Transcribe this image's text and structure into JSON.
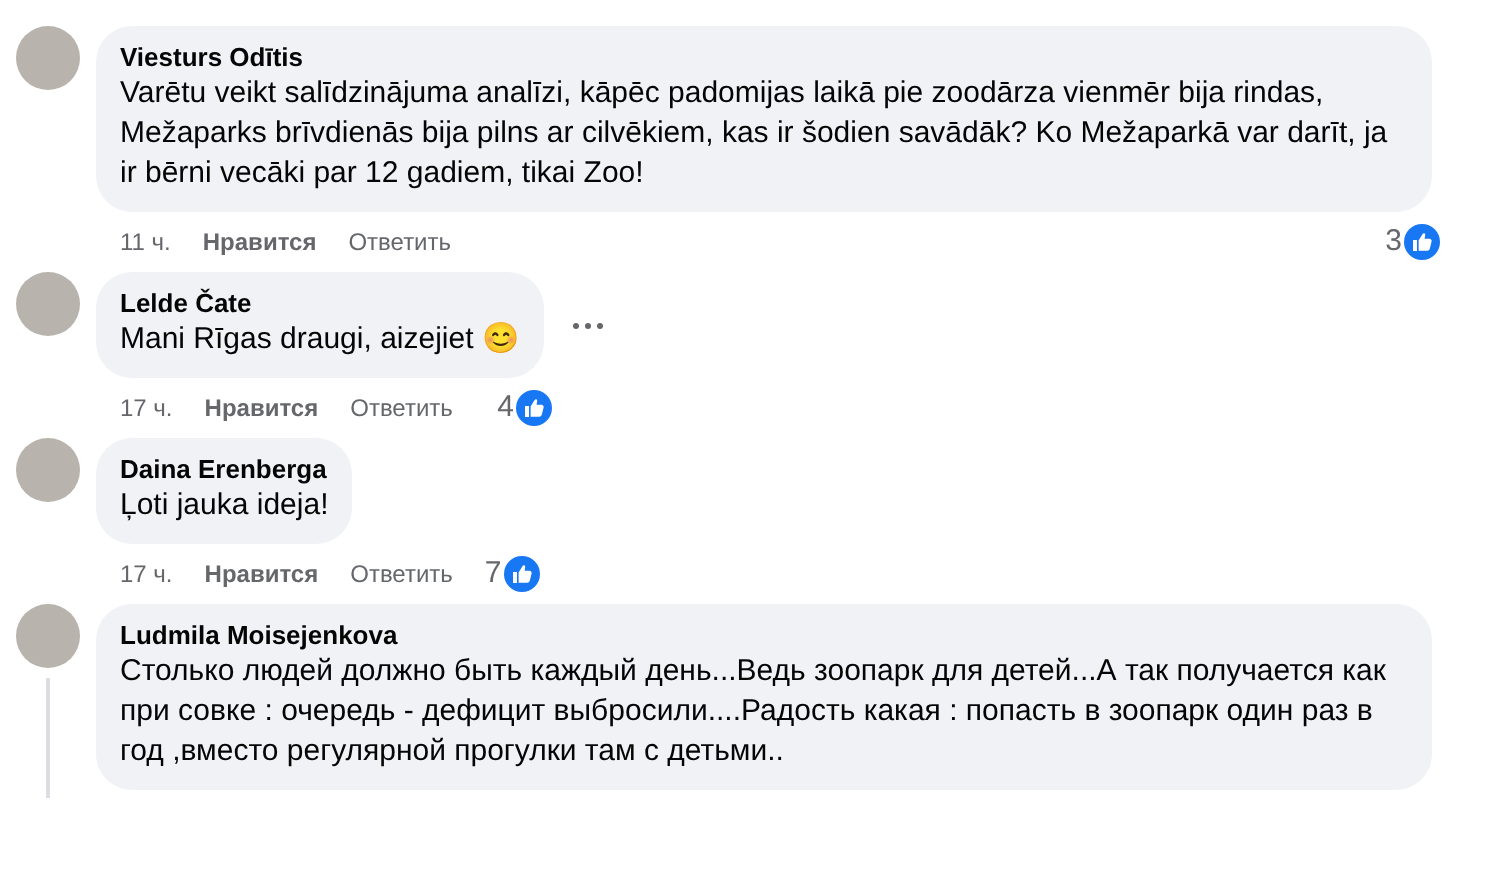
{
  "comments": [
    {
      "author": "Viesturs Odītis",
      "text": "Varētu veikt salīdzinājuma analīzi, kāpēc padomijas laikā pie zoodārza vienmēr bija rindas, Mežaparks brīvdienās bija pilns ar cilvēkiem, kas ir šodien savādāk? Ko Mežaparkā var darīt, ja ir bērni vecāki par 12 gadiem, tikai Zoo!",
      "time": "11 ч.",
      "like": "Нравится",
      "reply": "Ответить",
      "reactions": "3",
      "more_menu": false,
      "thread_line": false
    },
    {
      "author": "Lelde Čate",
      "text": "Mani Rīgas draugi, aizejiet 😊",
      "time": "17 ч.",
      "like": "Нравится",
      "reply": "Ответить",
      "reactions": "4",
      "more_menu": true,
      "thread_line": false
    },
    {
      "author": "Daina Erenberga",
      "text": "Ļoti jauka ideja!",
      "time": "17 ч.",
      "like": "Нравится",
      "reply": "Ответить",
      "reactions": "7",
      "more_menu": false,
      "thread_line": false
    },
    {
      "author": "Ludmila Moisejenkova",
      "text": "Столько людей должно быть каждый день...Ведь зоопарк для детей...А так получается как при совке : очередь - дефицит выбросили....Радость какая : попасть в зоопарк один раз в год ,вместо регулярной прогулки там с детьми..",
      "more_menu": false,
      "thread_line": true
    }
  ]
}
